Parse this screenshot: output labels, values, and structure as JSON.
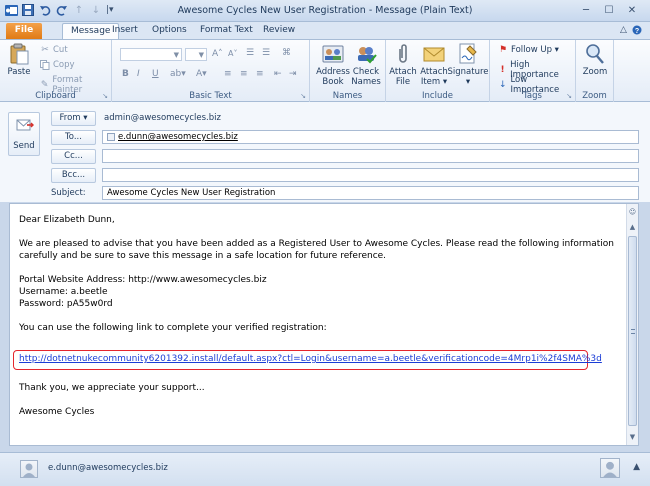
{
  "window": {
    "title": "Awesome Cycles New User Registration  -  Message (Plain Text)",
    "minimize": "─",
    "maximize": "☐",
    "close": "✕"
  },
  "qat": {
    "separator_glyph": "|▾"
  },
  "tabs": [
    {
      "label": "File"
    },
    {
      "label": "Message"
    },
    {
      "label": "Insert"
    },
    {
      "label": "Options"
    },
    {
      "label": "Format Text"
    },
    {
      "label": "Review"
    }
  ],
  "ribbon": {
    "clipboard": {
      "label": "Clipboard",
      "paste": "Paste",
      "cut": "Cut",
      "copy": "Copy",
      "format_painter": "Format Painter"
    },
    "basic_text": {
      "label": "Basic Text",
      "bold": "B",
      "italic": "I",
      "underline": "U"
    },
    "names": {
      "label": "Names",
      "address_book": [
        "Address",
        "Book"
      ],
      "check_names": [
        "Check",
        "Names"
      ]
    },
    "include": {
      "label": "Include",
      "attach_file": [
        "Attach",
        "File"
      ],
      "attach_item": [
        "Attach",
        "Item ▾"
      ],
      "signature": [
        "Signature",
        "▾"
      ]
    },
    "tags": {
      "label": "Tags",
      "follow_up": "Follow Up ▾",
      "high_importance": "High Importance",
      "low_importance": "Low Importance"
    },
    "zoom": {
      "label": "Zoom",
      "zoom": "Zoom"
    }
  },
  "header": {
    "send": "Send",
    "from_button": "From ▾",
    "from_value": "admin@awesomecycles.biz",
    "to_button": "To...",
    "to_value": "e.dunn@awesomecycles.biz",
    "cc_button": "Cc...",
    "cc_value": "",
    "bcc_button": "Bcc...",
    "bcc_value": "",
    "subject_label": "Subject:",
    "subject_value": "Awesome Cycles New User Registration"
  },
  "body": {
    "greeting": "Dear Elizabeth Dunn,",
    "para1_line1": "We are pleased to advise that you have been added as a Registered User to Awesome Cycles. Please read the following information",
    "para1_line2": "carefully and be sure to save this message in a safe location for future reference.",
    "portal": "Portal Website Address: http://www.awesomecycles.biz",
    "username": "Username: a.beetle",
    "password": "Password: pA55w0rd",
    "link_intro": "You can use the following link to complete your verified registration:",
    "link": "http://dotnetnukecommunity6201392.install/default.aspx?ctl=Login&username=a.beetle&verificationcode=4Mrp1i%2f4SMA%3d",
    "thanks": "Thank you, we appreciate your support...",
    "signoff": "Awesome Cycles"
  },
  "people_pane": {
    "name": "e.dunn@awesomecycles.biz",
    "toggle": "▲"
  },
  "colors": {
    "accent_file_tab": "#e07a14",
    "link": "#1a3dd6",
    "highlight_box": "#e5262d"
  }
}
